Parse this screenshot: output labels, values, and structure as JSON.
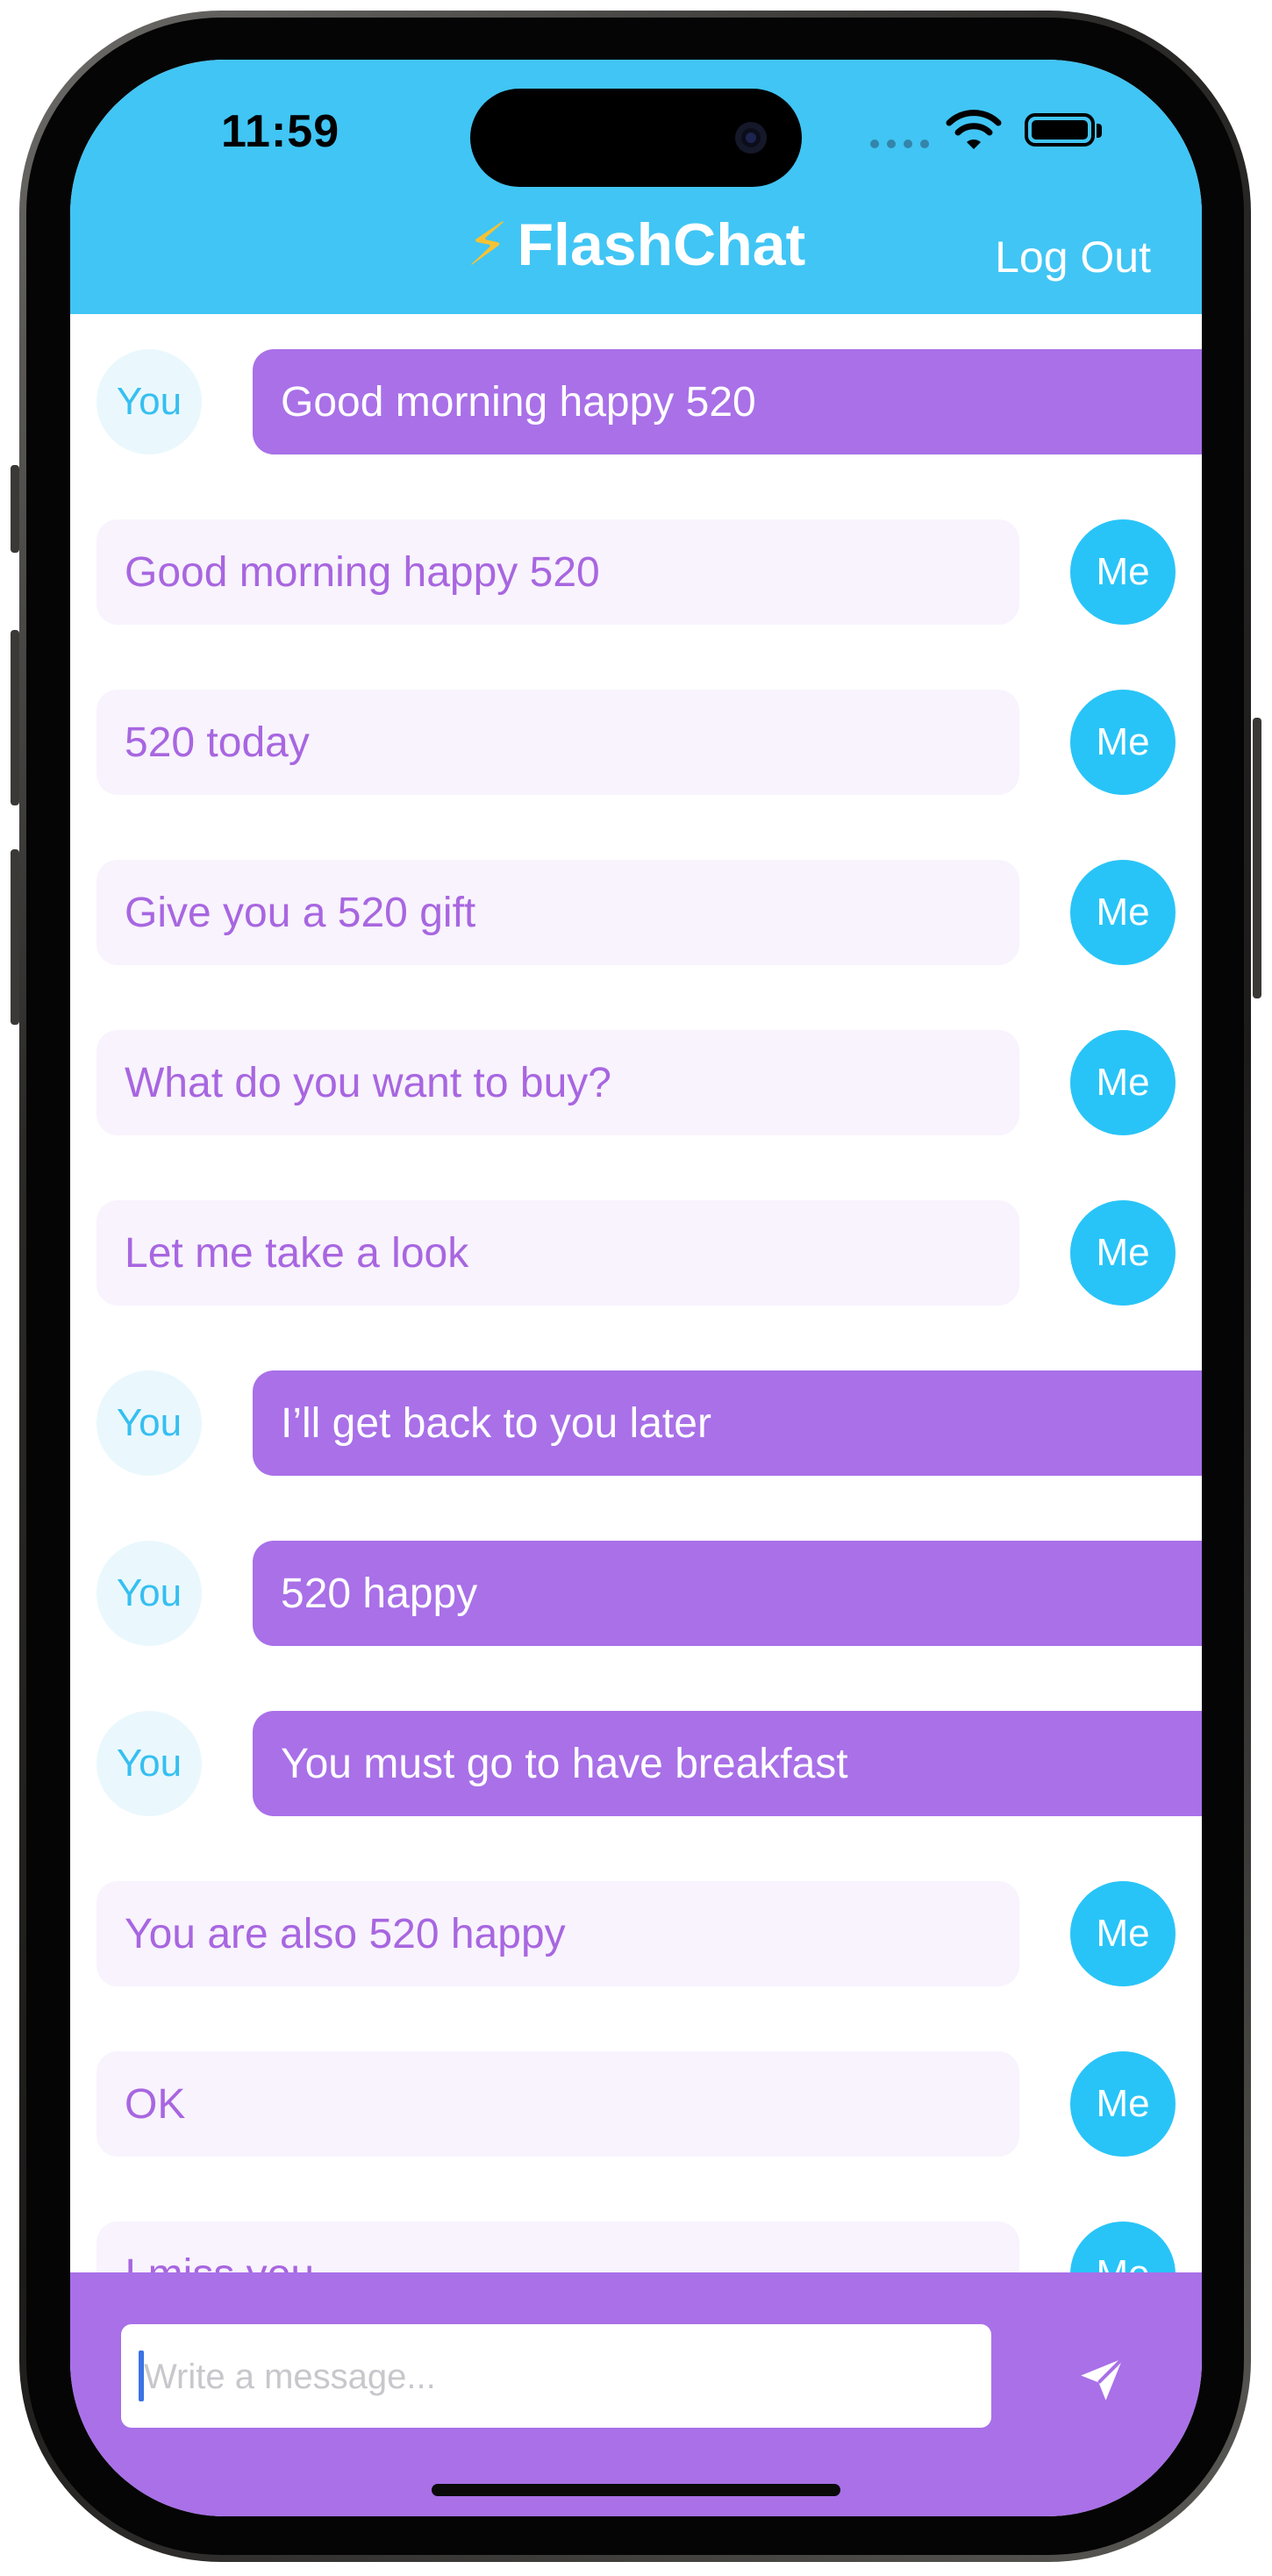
{
  "status_bar": {
    "time": "11:59"
  },
  "header": {
    "bolt_icon": "⚡",
    "title": "FlashChat",
    "logout_label": "Log Out",
    "color": "#41c5f4"
  },
  "avatars": {
    "you": "You",
    "me": "Me"
  },
  "messages": [
    {
      "sender": "you",
      "text": ""
    },
    {
      "sender": "you",
      "text": "Good morning happy 520"
    },
    {
      "sender": "me",
      "text": "Good morning happy 520"
    },
    {
      "sender": "me",
      "text": "520 today"
    },
    {
      "sender": "me",
      "text": "Give you a 520 gift"
    },
    {
      "sender": "me",
      "text": "What do you want to buy?"
    },
    {
      "sender": "me",
      "text": "Let me take a look"
    },
    {
      "sender": "you",
      "text": "I’ll get back to you later"
    },
    {
      "sender": "you",
      "text": "520 happy"
    },
    {
      "sender": "you",
      "text": "You must go to have breakfast"
    },
    {
      "sender": "me",
      "text": "You are also 520 happy"
    },
    {
      "sender": "me",
      "text": "OK"
    },
    {
      "sender": "me",
      "text": "I miss you"
    }
  ],
  "composer": {
    "placeholder": "Write a message...",
    "value": "",
    "send_icon": "paper-plane-icon",
    "color": "#a970e8"
  }
}
